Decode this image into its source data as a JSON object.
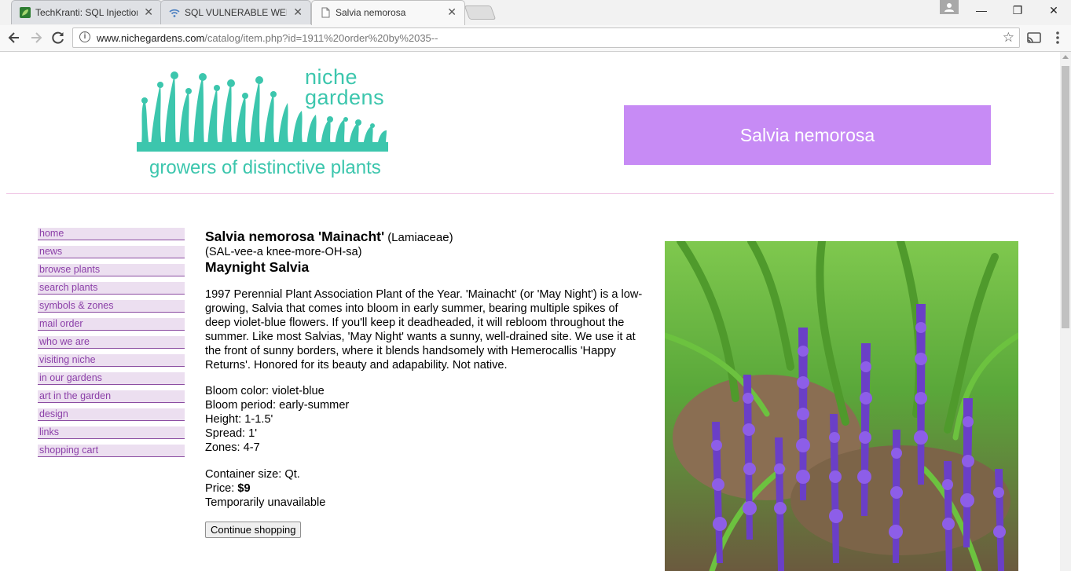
{
  "browser": {
    "tabs": [
      {
        "title": "TechKranti: SQL Injection",
        "active": false
      },
      {
        "title": "SQL VULNERABLE WEBSI",
        "active": false
      },
      {
        "title": "Salvia nemorosa",
        "active": true
      }
    ],
    "tab_close": "✕",
    "url_host": "www.nichegardens.com",
    "url_path": "/catalog/item.php?id=1911%20order%20by%2035--",
    "window_controls": {
      "minimize": "—",
      "maximize": "❐",
      "close": "✕"
    }
  },
  "header": {
    "logo_line1": "niche",
    "logo_line2": "gardens",
    "tagline": "growers of distinctive plants",
    "banner_title": "Salvia nemorosa"
  },
  "sidebar": {
    "items": [
      {
        "label": "home"
      },
      {
        "label": "news"
      },
      {
        "label": "browse plants"
      },
      {
        "label": "search plants"
      },
      {
        "label": "symbols & zones"
      },
      {
        "label": "mail order"
      },
      {
        "label": "who we are"
      },
      {
        "label": "visiting niche"
      },
      {
        "label": "in our gardens"
      },
      {
        "label": "art in the garden"
      },
      {
        "label": "design"
      },
      {
        "label": "links"
      },
      {
        "label": "shopping cart"
      }
    ]
  },
  "plant": {
    "scientific_name": "Salvia nemorosa 'Mainacht'",
    "family": "(Lamiaceae)",
    "pronunciation": "(SAL-vee-a knee-more-OH-sa)",
    "common_name": "Maynight Salvia",
    "description": "1997 Perennial Plant Association Plant of the Year. 'Mainacht' (or 'May Night') is a low-growing, Salvia that comes into bloom in early summer, bearing multiple spikes of deep violet-blue flowers. If you'll keep it deadheaded, it will rebloom throughout the summer. Like most Salvias, 'May Night' wants a sunny, well-drained site. We use it at the front of sunny borders, where it blends handsomely with Hemerocallis 'Happy Returns'. Honored for its beauty and adapability. Not native.",
    "bloom_color": "Bloom color: violet-blue",
    "bloom_period": "Bloom period: early-summer",
    "height": "Height: 1-1.5'",
    "spread": "Spread: 1'",
    "zones": "Zones: 4-7",
    "container_size": "Container size: Qt.",
    "price_label": "Price: ",
    "price_value": "$9",
    "availability": "Temporarily unavailable",
    "continue_label": "Continue shopping"
  },
  "colors": {
    "brand_teal": "#3cc6ad",
    "banner_purple": "#c78bf5",
    "nav_text": "#8b3fa8",
    "nav_bg": "#ecdff0"
  }
}
